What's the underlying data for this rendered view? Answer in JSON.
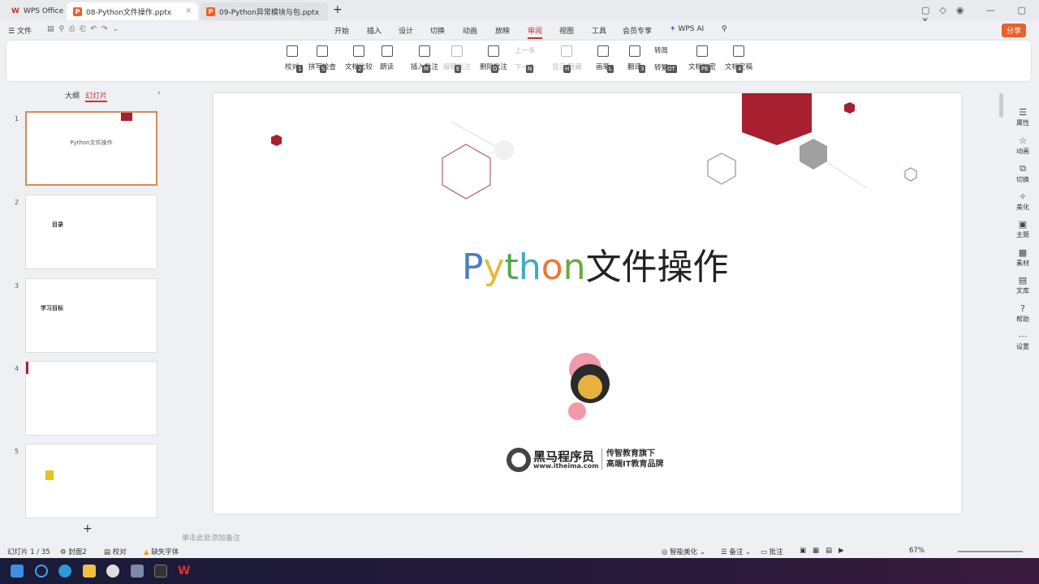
{
  "tabs": {
    "home": "WPS Office",
    "active": "08-Python文件操作.pptx",
    "other": "09-Python异常模块与包.pptx"
  },
  "menubar": {
    "file": "文件",
    "items": [
      "开始",
      "插入",
      "设计",
      "切换",
      "动画",
      "放映",
      "审阅",
      "视图",
      "工具",
      "会员专享",
      "WPS AI"
    ],
    "share": "分享"
  },
  "ribbon": [
    {
      "label": "校对",
      "key": "1",
      "disabled": false
    },
    {
      "label": "拼写检查",
      "key": "S",
      "disabled": false
    },
    {
      "label": "文档比较",
      "key": "2",
      "disabled": false
    },
    {
      "label": "朗读",
      "key": "",
      "disabled": false
    },
    {
      "label": "插入批注",
      "key": "M",
      "disabled": false
    },
    {
      "label": "编辑批注",
      "key": "E",
      "disabled": true
    },
    {
      "label": "删除批注",
      "key": "D",
      "disabled": false
    },
    {
      "label": "上一条",
      "key": "P",
      "disabled": true
    },
    {
      "label": "下一条",
      "key": "N",
      "disabled": true
    },
    {
      "label": "显示/隐藏",
      "key": "H",
      "disabled": true
    },
    {
      "label": "画笔",
      "key": "L",
      "disabled": false
    },
    {
      "label": "翻译",
      "key": "3",
      "disabled": false
    },
    {
      "label": "转简",
      "key": "OS",
      "disabled": false
    },
    {
      "label": "转繁",
      "key": "OT",
      "disabled": false
    },
    {
      "label": "文档加密",
      "key": "PE",
      "disabled": false
    },
    {
      "label": "文档定稿",
      "key": "4",
      "disabled": false
    }
  ],
  "leftpanel": {
    "tab_outline": "大纲",
    "tab_slides": "幻灯片",
    "slides": [
      "1",
      "2",
      "3",
      "4",
      "5"
    ],
    "thumb2": "目录",
    "thumb3": "学习目标",
    "thumb1": "Python文件操作"
  },
  "slide": {
    "title_letters": [
      "P",
      "y",
      "t",
      "h",
      "o",
      "n"
    ],
    "title_rest": "文件操作",
    "logo_name": "黑马程序员",
    "logo_url": "www.itheima.com",
    "logo_sub1": "传智教育旗下",
    "logo_sub2": "高端IT教育品牌"
  },
  "notes_placeholder": "单击此处添加备注",
  "rightbar": [
    "属性",
    "动画",
    "切换",
    "美化",
    "主题",
    "素材",
    "文库",
    "帮助",
    "设置"
  ],
  "status": {
    "slide": "幻灯片 1 / 35",
    "theme": "封面2",
    "proof": "校对",
    "font": "缺失字体",
    "beautify": "智能美化",
    "notes": "备注",
    "comment": "批注",
    "zoom": "67%"
  },
  "colors": {
    "accent": "#c7342b",
    "python": [
      "#4a7fc1",
      "#e8b83a",
      "#4fa84f",
      "#3fa9c9",
      "#e57a3a",
      "#6aaa3a"
    ]
  }
}
